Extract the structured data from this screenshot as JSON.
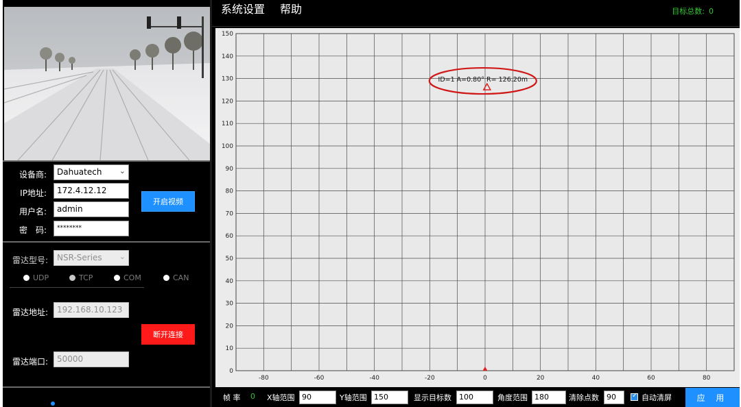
{
  "menu": {
    "settings": "系统设置",
    "help": "帮助"
  },
  "target_count": {
    "label": "目标总数:",
    "value": "0"
  },
  "camera": {
    "vendor_label": "设备商:",
    "vendor_value": "Dahuatech",
    "ip_label": "IP地址:",
    "ip_value": "172.4.12.12",
    "user_label": "用户名:",
    "user_value": "admin",
    "pwd_label": "密　码:",
    "pwd_value": "********",
    "open_video_button": "开启视频"
  },
  "radar": {
    "model_label": "雷达型号:",
    "model_value": "NSR-Series",
    "protocols": [
      "UDP",
      "TCP",
      "COM",
      "CAN"
    ],
    "address_label": "雷达地址:",
    "address_value": "192.168.10.123",
    "port_label": "雷达端口:",
    "port_value": "50000",
    "disconnect_button": "断开连接"
  },
  "bottom_bar": {
    "frame_rate_label": "帧 率",
    "frame_rate_value": "0",
    "x_range_label": "X轴范围",
    "x_range_value": "90",
    "y_range_label": "Y轴范围",
    "y_range_value": "150",
    "display_targets_label": "显示目标数",
    "display_targets_value": "100",
    "angle_range_label": "角度范围",
    "angle_range_value": "180",
    "clear_points_label": "清除点数",
    "clear_points_value": "90",
    "auto_clear_label": "自动清屏",
    "apply_button": "应 用"
  },
  "colors": {
    "accent": "#1e90ff",
    "danger": "#ff1a1a",
    "status_green": "#35c435",
    "target_red": "#e02020"
  },
  "chart_data": {
    "type": "scatter",
    "x_ticks": [
      -80,
      -60,
      -40,
      -20,
      0,
      20,
      40,
      60,
      80
    ],
    "y_ticks": [
      0,
      10,
      20,
      30,
      40,
      50,
      60,
      70,
      80,
      90,
      100,
      110,
      120,
      130,
      140,
      150
    ],
    "xlim": [
      -90,
      90
    ],
    "ylim": [
      0,
      150
    ],
    "grid": true,
    "targets": [
      {
        "x": 0.7,
        "y": 126.2,
        "label": "ID=1 A=0.80° R= 126.20m"
      }
    ],
    "origin_marker": {
      "x": 0,
      "y": 0
    }
  }
}
